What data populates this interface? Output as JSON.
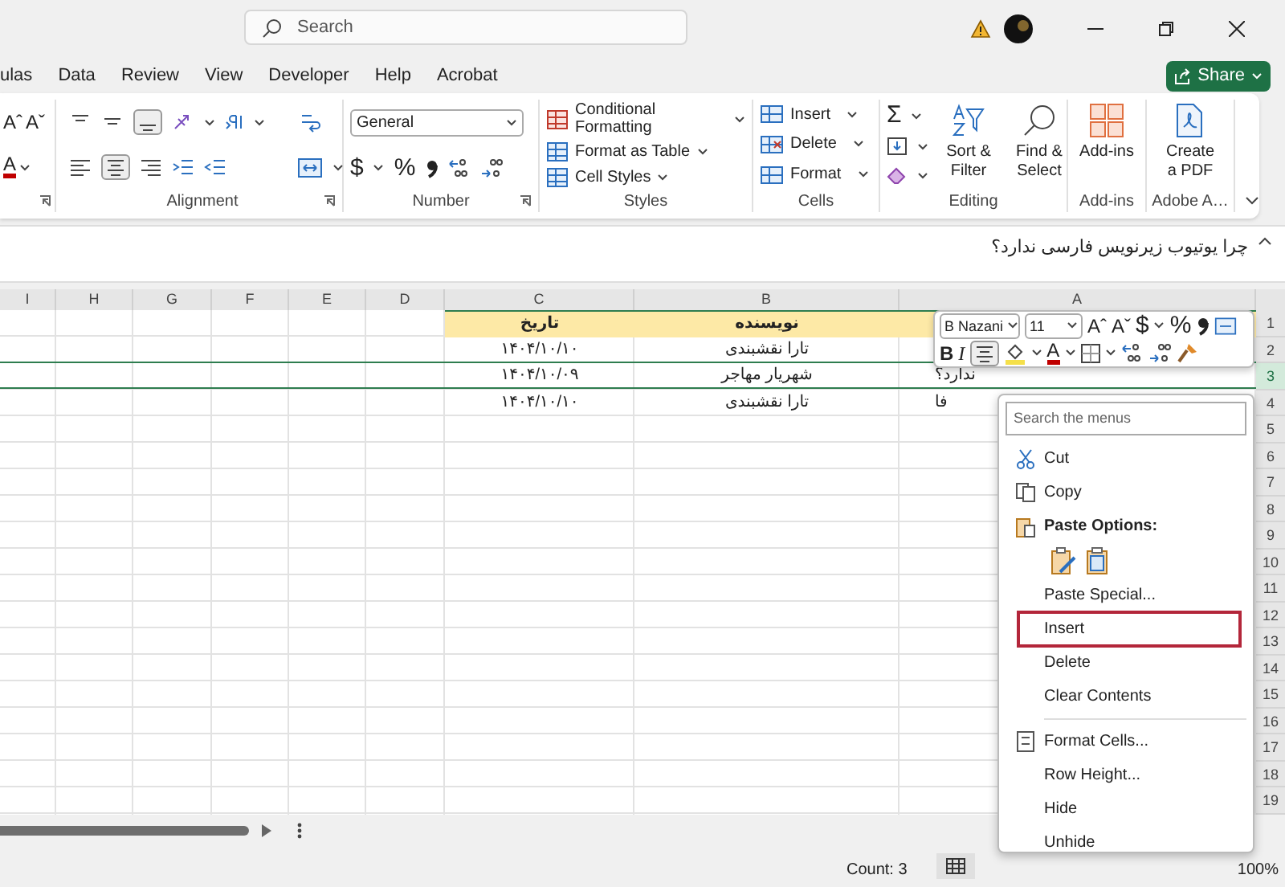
{
  "title_bar": {
    "search_placeholder": "Search"
  },
  "menu_tabs": [
    {
      "label": "ulas",
      "selected": false
    },
    {
      "label": "Data",
      "selected": false
    },
    {
      "label": "Review",
      "selected": false
    },
    {
      "label": "View",
      "selected": false
    },
    {
      "label": "Developer",
      "selected": false
    },
    {
      "label": "Help",
      "selected": false
    },
    {
      "label": "Acrobat",
      "selected": false
    }
  ],
  "share_button": "Share",
  "ribbon": {
    "font_group": {
      "grow_font": "Aˆ",
      "shrink_font": "Aˇ",
      "font_color": "A"
    },
    "alignment": {
      "label": "Alignment"
    },
    "number": {
      "format": "General",
      "currency": "$",
      "percent": "%",
      "label": "Number"
    },
    "styles": {
      "items": [
        "Conditional Formatting",
        "Format as Table",
        "Cell Styles"
      ],
      "label": "Styles"
    },
    "cells": {
      "items": [
        "Insert",
        "Delete",
        "Format"
      ],
      "label": "Cells"
    },
    "editing": {
      "autosum": "Σ",
      "sort": "Sort & Filter",
      "find": "Find & Select",
      "label": "Editing"
    },
    "addins": {
      "button": "Add-ins",
      "label": "Add-ins"
    },
    "adobe": {
      "button": "Create a PDF",
      "label": "Adobe A…"
    }
  },
  "formula_bar": {
    "value": "چرا یوتیوب زیرنویس فارسی ندارد؟"
  },
  "sheet": {
    "columns": [
      "I",
      "H",
      "G",
      "F",
      "E",
      "D",
      "C",
      "B",
      "A"
    ],
    "rows": [
      {
        "number": "1",
        "kind": "header",
        "selected": false,
        "cells": [
          null,
          null,
          null,
          null,
          null,
          null,
          "تاریخ",
          "نویسنده",
          null
        ]
      },
      {
        "number": "2",
        "kind": "data",
        "selected": false,
        "cells": [
          null,
          null,
          null,
          null,
          null,
          null,
          "۱۴۰۴/۱۰/۱۰",
          "تارا نقشبندی",
          null
        ]
      },
      {
        "number": "3",
        "kind": "data",
        "selected": true,
        "cells": [
          null,
          null,
          null,
          null,
          null,
          null,
          "۱۴۰۴/۱۰/۰۹",
          "شهریار مهاجر",
          "ندارد؟"
        ]
      },
      {
        "number": "4",
        "kind": "data",
        "selected": false,
        "cells": [
          null,
          null,
          null,
          null,
          null,
          null,
          "۱۴۰۴/۱۰/۱۰",
          "تارا نقشبندی",
          "فا"
        ]
      },
      {
        "number": "5",
        "kind": "data",
        "selected": false,
        "cells": []
      },
      {
        "number": "6",
        "kind": "data",
        "selected": false,
        "cells": []
      },
      {
        "number": "7",
        "kind": "data",
        "selected": false,
        "cells": []
      },
      {
        "number": "8",
        "kind": "data",
        "selected": false,
        "cells": []
      },
      {
        "number": "9",
        "kind": "data",
        "selected": false,
        "cells": []
      },
      {
        "number": "10",
        "kind": "data",
        "selected": false,
        "cells": []
      },
      {
        "number": "11",
        "kind": "data",
        "selected": false,
        "cells": []
      },
      {
        "number": "12",
        "kind": "data",
        "selected": false,
        "cells": []
      },
      {
        "number": "13",
        "kind": "data",
        "selected": false,
        "cells": []
      },
      {
        "number": "14",
        "kind": "data",
        "selected": false,
        "cells": []
      },
      {
        "number": "15",
        "kind": "data",
        "selected": false,
        "cells": []
      },
      {
        "number": "16",
        "kind": "data",
        "selected": false,
        "cells": []
      },
      {
        "number": "17",
        "kind": "data",
        "selected": false,
        "cells": []
      },
      {
        "number": "18",
        "kind": "data",
        "selected": false,
        "cells": []
      },
      {
        "number": "19",
        "kind": "data",
        "selected": false,
        "cells": []
      }
    ]
  },
  "mini_toolbar": {
    "font": "B Nazani",
    "size": "11",
    "grow_font": "Aˆ",
    "shrink_font": "Aˇ",
    "currency": "$",
    "percent": "%",
    "bold": "B",
    "italic": "I",
    "font_color": "A"
  },
  "context_menu": {
    "search_placeholder": "Search the menus",
    "items": [
      {
        "kind": "cut",
        "label": "Cut",
        "highlighted": false
      },
      {
        "kind": "copy",
        "label": "Copy",
        "highlighted": false
      },
      {
        "kind": "paste-heading",
        "label": "Paste Options:"
      },
      {
        "kind": "paste-icons"
      },
      {
        "kind": "item",
        "label": "Paste Special...",
        "highlighted": false
      },
      {
        "kind": "item",
        "label": "Insert",
        "highlighted": true
      },
      {
        "kind": "item",
        "label": "Delete",
        "highlighted": false
      },
      {
        "kind": "item",
        "label": "Clear Contents",
        "highlighted": false
      },
      {
        "kind": "separator"
      },
      {
        "kind": "format",
        "label": "Format Cells...",
        "highlighted": false
      },
      {
        "kind": "item",
        "label": "Row Height...",
        "highlighted": false
      },
      {
        "kind": "item",
        "label": "Hide",
        "highlighted": false
      },
      {
        "kind": "item",
        "label": "Unhide",
        "highlighted": false
      }
    ]
  },
  "status_bar": {
    "count": "Count: 3",
    "zoom": "100%"
  }
}
